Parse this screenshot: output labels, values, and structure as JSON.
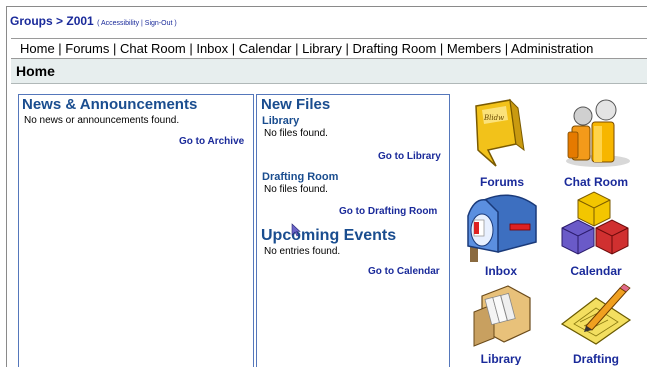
{
  "breadcrumb": {
    "groups": "Groups",
    "sep": " > ",
    "group": "Z001",
    "links": "( Accessibility | Sign-Out )"
  },
  "nav": {
    "items": [
      "Home",
      "Forums",
      "Chat Room",
      "Inbox",
      "Calendar",
      "Library",
      "Drafting Room",
      "Members",
      "Administration"
    ]
  },
  "page": {
    "title": "Home"
  },
  "news": {
    "title": "News & Announcements",
    "empty": "No news or announcements found.",
    "link": "Go to Archive"
  },
  "newfiles": {
    "title": "New Files",
    "library": {
      "heading": "Library",
      "empty": "No files found.",
      "link": "Go to Library"
    },
    "drafting": {
      "heading": "Drafting Room",
      "empty": "No files found.",
      "link": "Go to Drafting Room"
    }
  },
  "events": {
    "title": "Upcoming Events",
    "empty": "No entries found.",
    "link": "Go to Calendar"
  },
  "shortcuts": {
    "forums": "Forums",
    "chat": "Chat Room",
    "inbox": "Inbox",
    "calendar": "Calendar",
    "library": "Library",
    "drafting": "Drafting"
  },
  "colors": {
    "link": "#1a2a9a",
    "heading": "#1a4d8f",
    "titlebar_bg": "#e7eeee",
    "panel_border": "#5577bb"
  }
}
